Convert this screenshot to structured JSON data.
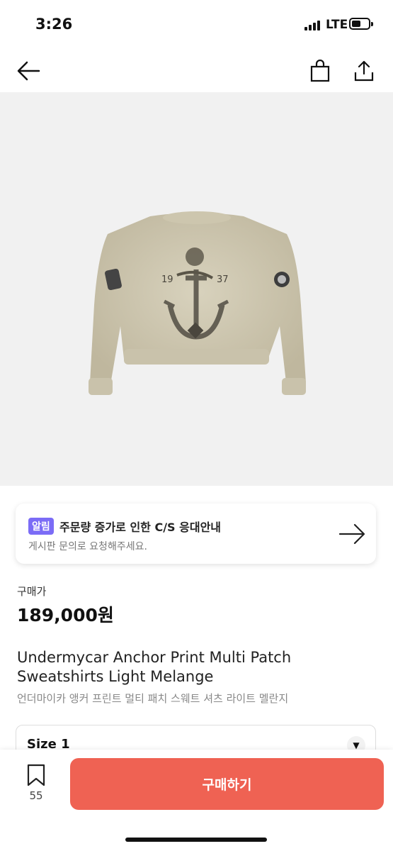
{
  "status": {
    "time": "3:26",
    "network": "LTE"
  },
  "notice": {
    "badge": "알림",
    "title": "주문량 증가로 인한 C/S 응대안내",
    "subtitle": "게시판 문의로 요청해주세요."
  },
  "price": {
    "label": "구매가",
    "value": "189,000원"
  },
  "product": {
    "name": "Undermycar Anchor Print Multi Patch Sweatshirts Light Melange",
    "name_ko": "언더마이카 앵커 프린트 멀티 패치 스웨트 셔츠 라이트 멜란지",
    "print_left": "19",
    "print_right": "37"
  },
  "size": {
    "selected": "Size 1"
  },
  "bottom": {
    "bookmark_count": "55",
    "buy_label": "구매하기"
  },
  "colors": {
    "accent": "#ef6253",
    "badge": "#7b6cf6"
  }
}
